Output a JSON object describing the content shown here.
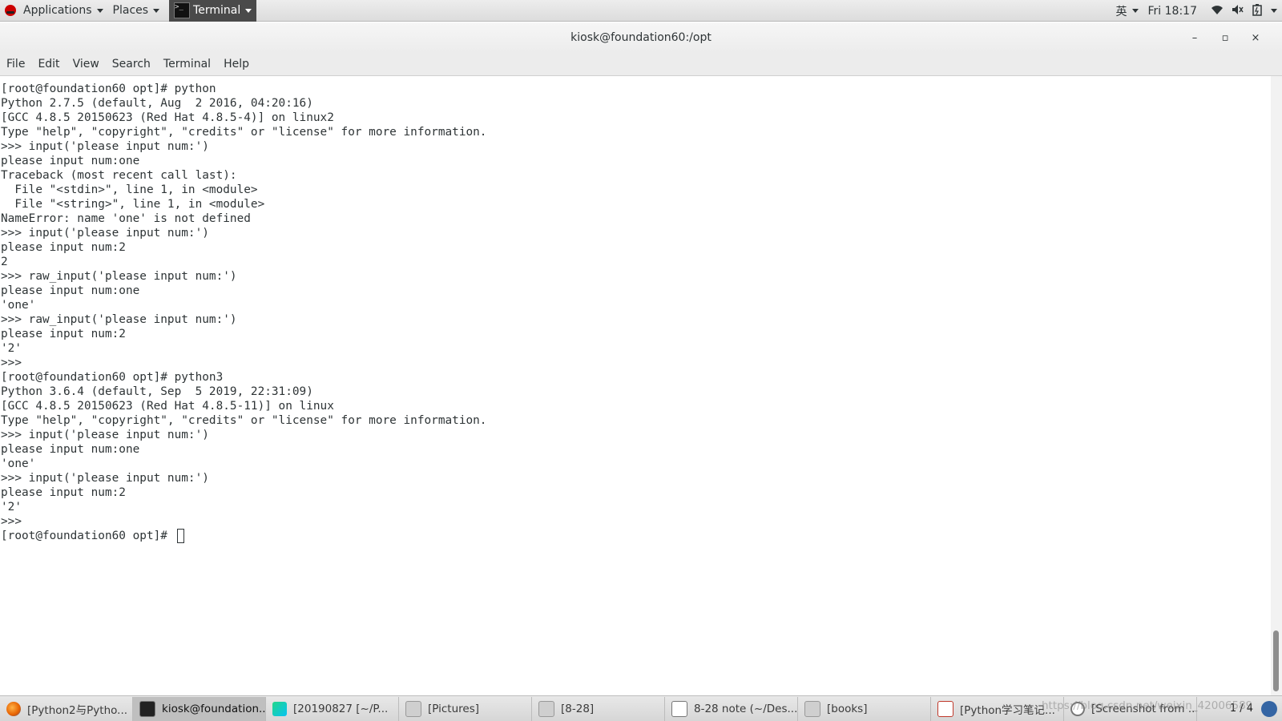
{
  "top_panel": {
    "applications": "Applications",
    "places": "Places",
    "active_app": "Terminal",
    "input_method": "英",
    "clock": "Fri 18:17"
  },
  "window": {
    "title": "kiosk@foundation60:/opt",
    "minimize": "–",
    "maximize": "▫",
    "close": "×"
  },
  "menu": [
    "File",
    "Edit",
    "View",
    "Search",
    "Terminal",
    "Help"
  ],
  "terminal": {
    "lines": [
      "[root@foundation60 opt]# python",
      "Python 2.7.5 (default, Aug  2 2016, 04:20:16)",
      "[GCC 4.8.5 20150623 (Red Hat 4.8.5-4)] on linux2",
      "Type \"help\", \"copyright\", \"credits\" or \"license\" for more information.",
      ">>> input('please input num:')",
      "please input num:one",
      "Traceback (most recent call last):",
      "  File \"<stdin>\", line 1, in <module>",
      "  File \"<string>\", line 1, in <module>",
      "NameError: name 'one' is not defined",
      ">>> input('please input num:')",
      "please input num:2",
      "2",
      ">>> raw_input('please input num:')",
      "please input num:one",
      "'one'",
      ">>> raw_input('please input num:')",
      "please input num:2",
      "'2'",
      ">>>",
      "[root@foundation60 opt]# python3",
      "Python 3.6.4 (default, Sep  5 2019, 22:31:09)",
      "[GCC 4.8.5 20150623 (Red Hat 4.8.5-11)] on linux",
      "Type \"help\", \"copyright\", \"credits\" or \"license\" for more information.",
      ">>> input('please input num:')",
      "please input num:one",
      "'one'",
      ">>> input('please input num:')",
      "please input num:2",
      "'2'",
      ">>>"
    ],
    "prompt": "[root@foundation60 opt]# "
  },
  "taskbar": {
    "tasks": [
      {
        "label": "[Python2与Pytho...",
        "icon": "firefox-icon",
        "active": false
      },
      {
        "label": "kiosk@foundation...",
        "icon": "terminal-icon",
        "active": true
      },
      {
        "label": "[20190827 [~/P...",
        "icon": "pycharm-icon",
        "active": false
      },
      {
        "label": "[Pictures]",
        "icon": "folder-icon",
        "active": false
      },
      {
        "label": "[8-28]",
        "icon": "folder-icon",
        "active": false
      },
      {
        "label": "8-28 note (~/Des...",
        "icon": "note-icon",
        "active": false
      },
      {
        "label": "[books]",
        "icon": "folder-icon",
        "active": false
      },
      {
        "label": "[Python学习笔记...",
        "icon": "document-icon",
        "active": false
      },
      {
        "label": "[Screenshot from ...",
        "icon": "magnifier-icon",
        "active": false
      }
    ],
    "pager": "1 / 4",
    "watermark": "https://blog.csdn.net/weixin_42006589"
  }
}
